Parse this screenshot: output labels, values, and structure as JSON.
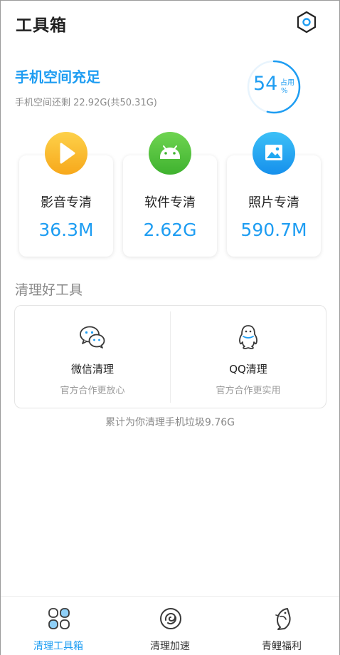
{
  "header": {
    "title": "工具箱",
    "settings_icon": "settings-hexagon-icon"
  },
  "storage": {
    "status": "手机空间充足",
    "remaining_text": "手机空间还剩 22.92G(共50.31G)",
    "used_percent": 54,
    "used_label": "占用",
    "percent_sign": "%"
  },
  "categories": [
    {
      "label": "影音专清",
      "value": "36.3M",
      "icon": "play-icon",
      "color": "#f9b820"
    },
    {
      "label": "软件专清",
      "value": "2.62G",
      "icon": "android-icon",
      "color": "#53c43f"
    },
    {
      "label": "照片专清",
      "value": "590.7M",
      "icon": "image-icon",
      "color": "#1fa8f2"
    }
  ],
  "tools_section": {
    "title": "清理好工具",
    "items": [
      {
        "name": "微信清理",
        "desc": "官方合作更放心",
        "icon": "wechat-icon"
      },
      {
        "name": "QQ清理",
        "desc": "官方合作更实用",
        "icon": "qq-penguin-icon"
      }
    ]
  },
  "total_cleaned": "累计为你清理手机垃圾9.76G",
  "bottom_nav": [
    {
      "label": "清理工具箱",
      "icon": "toolbox-grid-icon",
      "active": true
    },
    {
      "label": "清理加速",
      "icon": "speed-swirl-icon",
      "active": false
    },
    {
      "label": "青鲤福利",
      "icon": "carp-fish-icon",
      "active": false
    }
  ],
  "colors": {
    "accent": "#1e9df2",
    "text": "#222222",
    "muted": "#8c8c8c"
  }
}
